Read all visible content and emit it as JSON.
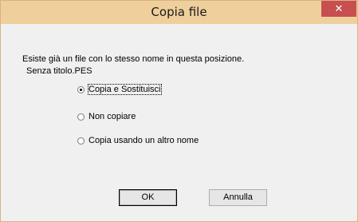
{
  "window": {
    "title": "Copia file",
    "close_glyph": "✕"
  },
  "message": {
    "line1": "Esiste già un file con lo stesso nome in questa posizione.",
    "line2": "Senza titolo.PES"
  },
  "options": [
    {
      "label": "Copia e Sostituisci",
      "selected": true
    },
    {
      "label": "Non copiare",
      "selected": false
    },
    {
      "label": "Copia usando un altro nome",
      "selected": false
    }
  ],
  "buttons": {
    "ok": "OK",
    "cancel": "Annulla"
  },
  "colors": {
    "titlebar": "#efcf9b",
    "close_button": "#c74f4f",
    "dialog_background": "#f0f0f0"
  }
}
